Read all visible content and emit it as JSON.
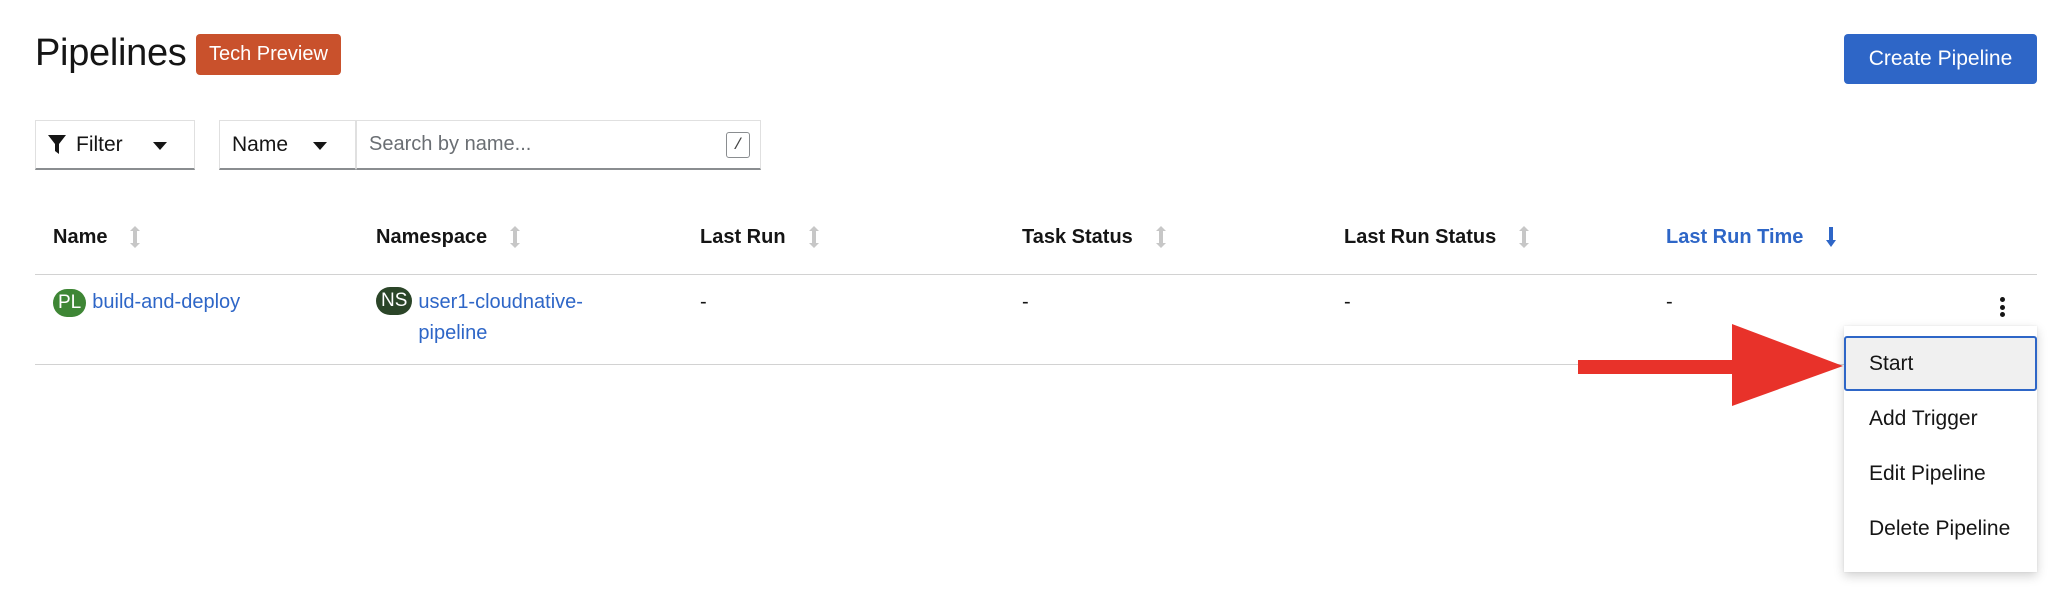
{
  "header": {
    "title": "Pipelines",
    "badge": "Tech Preview",
    "create_button": "Create Pipeline"
  },
  "toolbar": {
    "filter_label": "Filter",
    "filter_icon": "filter-funnel-icon",
    "field_select": "Name",
    "search_placeholder": "Search by name...",
    "search_shortcut": "/"
  },
  "table": {
    "columns": [
      {
        "label": "Name",
        "sort": "sortable"
      },
      {
        "label": "Namespace",
        "sort": "sortable"
      },
      {
        "label": "Last Run",
        "sort": "sortable"
      },
      {
        "label": "Task Status",
        "sort": "sortable"
      },
      {
        "label": "Last Run Status",
        "sort": "sortable"
      },
      {
        "label": "Last Run Time",
        "sort": "descending"
      }
    ],
    "rows": [
      {
        "name_badge": "PL",
        "name": "build-and-deploy",
        "namespace_badge": "NS",
        "namespace": "user1-cloudnative-pipeline",
        "last_run": "-",
        "task_status": "-",
        "last_run_status": "-",
        "last_run_time": "-"
      }
    ]
  },
  "row_menu": {
    "items": [
      "Start",
      "Add Trigger",
      "Edit Pipeline",
      "Delete Pipeline"
    ],
    "focused": "Start"
  },
  "colors": {
    "primary": "#2e66c7",
    "tech_preview_badge": "#c9512c",
    "pipeline_badge": "#3e8635",
    "namespace_badge": "#2b4528",
    "annotation_arrow": "#e8322a"
  },
  "icons": {
    "kebab": "kebab-menu-icon",
    "sort": "sort-arrows-icon",
    "sort_desc": "sort-descending-icon"
  }
}
